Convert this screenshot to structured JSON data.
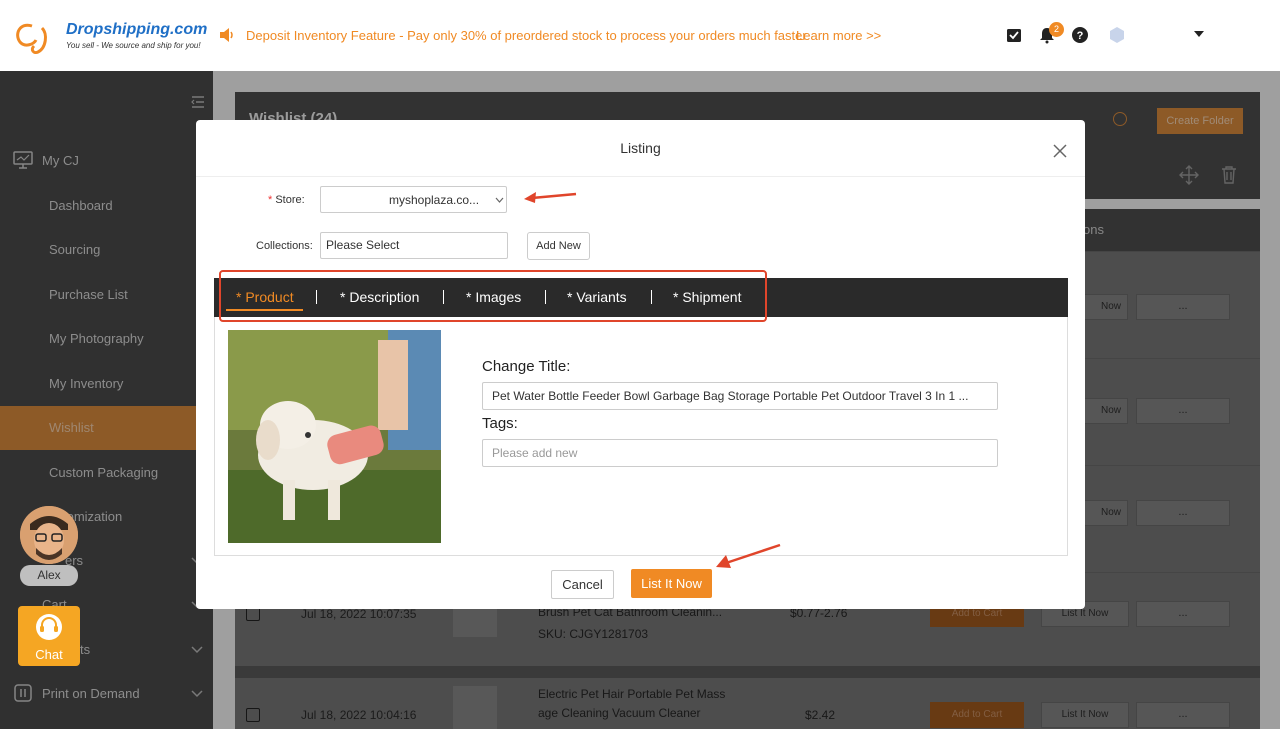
{
  "header": {
    "logo_text": "Dropshipping.com",
    "logo_sub": "You sell - We source and ship for you!",
    "announcement": "Deposit Inventory Feature - Pay only 30% of preordered stock to process your orders much faster",
    "learn_more": "Learn more >>",
    "notification_count": "2",
    "accent": "#f08a24"
  },
  "sidebar": {
    "items": [
      {
        "label": "My CJ",
        "icon": "monitor-icon"
      },
      {
        "label": "Dashboard"
      },
      {
        "label": "Sourcing"
      },
      {
        "label": "Purchase List"
      },
      {
        "label": "My Photography"
      },
      {
        "label": "My Inventory"
      },
      {
        "label": "Wishlist",
        "active": true
      },
      {
        "label": "Custom Packaging"
      },
      {
        "label": "Customization"
      },
      {
        "label": "Orders"
      },
      {
        "label": "Cart"
      },
      {
        "label": "Products"
      },
      {
        "label": "Print on Demand"
      }
    ],
    "customization_partial": "tomization",
    "orders_partial": "ers",
    "cart_partial": "Cart",
    "products_partial": "ts"
  },
  "main": {
    "wishlist_title": "Wishlist (24)",
    "create_folder": "Create Folder",
    "operations_col": "Operations",
    "operations_partial": "ons",
    "rows": [
      {
        "date": "Jul 18, 2022 10:07:35",
        "name": "Brush Pet Cat Bathroom Cleanin...",
        "sku": "SKU: CJGY1281703",
        "price": "$0.77-2.76",
        "cart": "Add to Cart",
        "list": "List It Now",
        "more": "..."
      },
      {
        "date": "Jul 18, 2022 10:04:16",
        "name_line1": "Electric Pet Hair Portable Pet Mass",
        "name_line2": "age Cleaning Vacuum Cleaner",
        "price": "$2.42",
        "cart": "Add to Cart",
        "list": "List It Now",
        "more": "..."
      }
    ],
    "ghost_list": "Now",
    "ghost_more": "..."
  },
  "modal": {
    "title": "Listing",
    "store_label": "Store:",
    "store_value": "myshoplaza.co...",
    "collections_label": "Collections:",
    "collections_value": "Please Select",
    "add_new": "Add New",
    "tabs": [
      "* Product",
      "* Description",
      "* Images",
      "* Variants",
      "* Shipment"
    ],
    "change_title_label": "Change Title:",
    "title_value": "Pet Water Bottle Feeder Bowl Garbage Bag Storage Portable Pet Outdoor Travel 3 In 1 ...",
    "tags_label": "Tags:",
    "tags_placeholder": "Please add new",
    "cancel": "Cancel",
    "list_it_now": "List It Now"
  },
  "float": {
    "agent_name": "Alex",
    "chat": "Chat"
  }
}
